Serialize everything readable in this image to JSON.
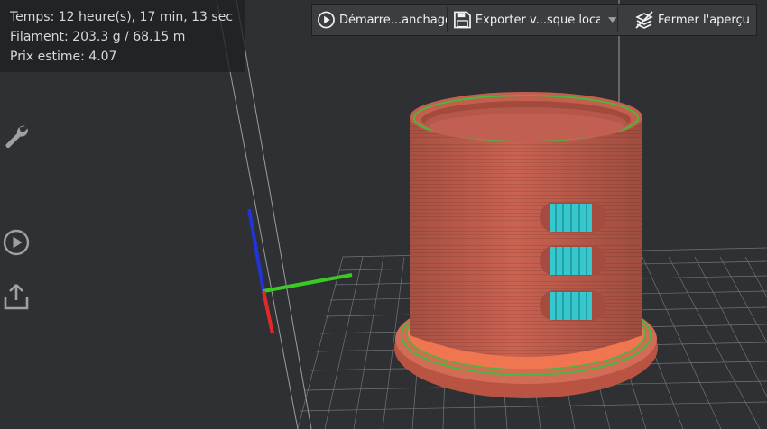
{
  "stats": {
    "time": "Temps: 12 heure(s), 17 min, 13 sec",
    "filament": "Filament: 203.3 g / 68.15 m",
    "price": "Prix estime: 4.07"
  },
  "toolbar": {
    "start_label": "Démarre...anchage",
    "export_label": "Exporter v...sque local",
    "close_preview_label": "Fermer l'aperçu"
  },
  "sidebar": {
    "icons": [
      "wrench-icon",
      "play-circle-icon",
      "share-upload-icon"
    ]
  },
  "colors": {
    "toolbar_bg": "#3b3d40",
    "model_body": "#c8614f",
    "infill": "#35c9cf",
    "perimeter_green": "#47b83b",
    "base_orange": "#f07652",
    "axis_x": "#e02a2a",
    "axis_y": "#3acb22",
    "axis_z": "#2233d8"
  }
}
